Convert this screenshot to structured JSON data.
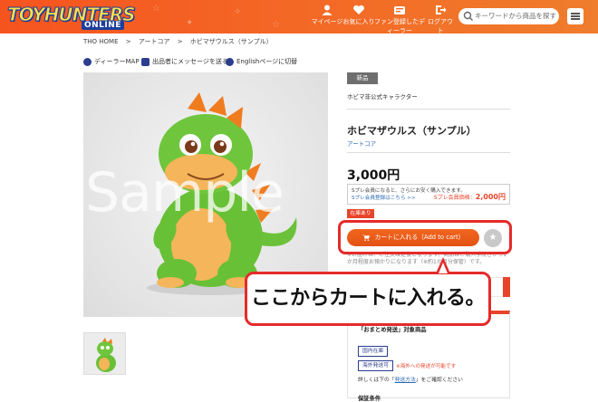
{
  "header": {
    "logo_main": "TOYHUNTERS",
    "logo_sub": "ONLINE",
    "nav": [
      {
        "label": "マイページ",
        "icon": "user-icon"
      },
      {
        "label": "お気に入り",
        "icon": "heart-icon"
      },
      {
        "label": "ファン登録したディーラー",
        "icon": "fan-register-icon"
      },
      {
        "label": "ログアウト",
        "icon": "logout-icon"
      }
    ],
    "search_placeholder": "キーワードから商品を探す",
    "brand_color": "#f36a26"
  },
  "breadcrumb": [
    "THO HOME",
    ">",
    "アートコア",
    ">",
    "ホビマザウルス（サンプル）"
  ],
  "links": [
    {
      "label": "ディーラーMAP",
      "icon": "person-icon"
    },
    {
      "label": "出品者にメッセージを送る",
      "icon": "message-icon"
    },
    {
      "label": "Englishページに切替",
      "icon": "language-icon"
    }
  ],
  "product": {
    "watermark": "Sample",
    "badge": "新品",
    "copyright": "ホビマ非公式キャラクター",
    "name": "ホビマザウルス（サンプル）",
    "maker": "アートコア",
    "price": "3,000円",
    "splay_note": "Sプレ会員になると、さらにお安く購入できます。",
    "splay_link": "Sプレ会員登録はこちら >>",
    "splay_price_label": "Sプレ会員価格：",
    "splay_price": "2,000円",
    "stock": "在庫あり",
    "cart_button": "カートに入れる（Add to cart）",
    "fav_icon": "star-icon",
    "note": "※お届けは、ご注文確定後となります。商品はご購入手続きから1か月程度お預かりになります（※約1か月分保管）です。"
  },
  "callout": "ここからカートに入れる。",
  "matome": {
    "title": "「おまとめ発送」対象商品",
    "tag1": "国内在庫",
    "tag2": "海外発送可",
    "overseas_note": "※海外への発送が可能です",
    "detail_prefix": "詳しくは下の「",
    "detail_link": "発送方法",
    "detail_suffix": "」をご確認ください",
    "warranty": "保証条件"
  }
}
